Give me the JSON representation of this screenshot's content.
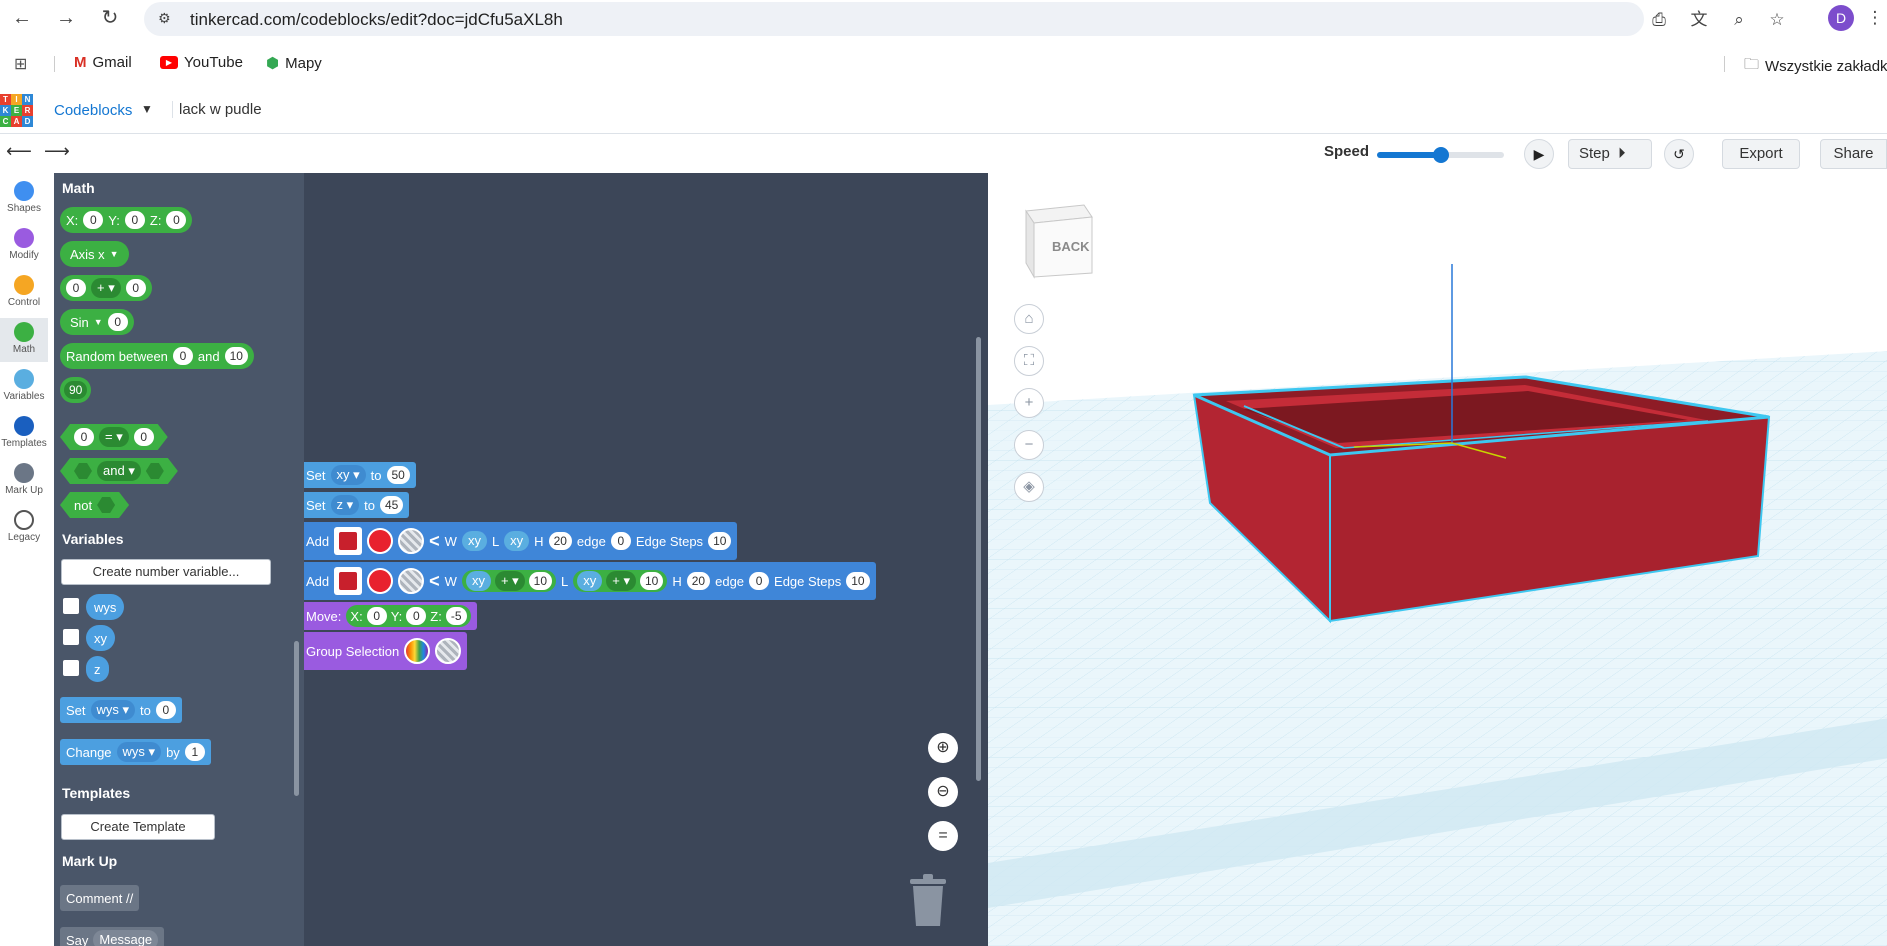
{
  "browser": {
    "url": "tinkercad.com/codeblocks/edit?doc=jdCfu5aXL8h",
    "profile_initial": "D",
    "bookmarks": [
      "Gmail",
      "YouTube",
      "Mapy"
    ],
    "all_bookmarks": "Wszystkie zakładki"
  },
  "header": {
    "logo_letters": [
      "T",
      "I",
      "N",
      "K",
      "E",
      "R",
      "C",
      "A",
      "D"
    ],
    "app_name": "Codeblocks",
    "doc_name": "lack w pudle"
  },
  "toolbar": {
    "speed_label": "Speed",
    "speed_value": 0.5,
    "step_label": "Step",
    "export_label": "Export",
    "share_label": "Share"
  },
  "categories": [
    {
      "label": "Shapes",
      "color": "#3f8ff0"
    },
    {
      "label": "Modify",
      "color": "#9a5be0"
    },
    {
      "label": "Control",
      "color": "#f5a623"
    },
    {
      "label": "Math",
      "color": "#3cb043"
    },
    {
      "label": "Variables",
      "color": "#5aaee0"
    },
    {
      "label": "Templates",
      "color": "#1a5fbf"
    },
    {
      "label": "Mark Up",
      "color": "#6b7686"
    },
    {
      "label": "Legacy",
      "color": "#ffffff"
    }
  ],
  "palette": {
    "math_title": "Math",
    "xyz_labels": [
      "X:",
      "Y:",
      "Z:"
    ],
    "xyz_values": [
      "0",
      "0",
      "0"
    ],
    "axis_label": "Axis x",
    "arith": {
      "a": "0",
      "op": "+",
      "b": "0"
    },
    "sin_label": "Sin",
    "sin_value": "0",
    "random_label": "Random between",
    "random_and": "and",
    "random_min": "0",
    "random_max": "10",
    "number_block": "90",
    "compare": {
      "a": "0",
      "op": "=",
      "b": "0"
    },
    "and_label": "and",
    "not_label": "not",
    "variables_title": "Variables",
    "create_var_btn": "Create number variable...",
    "vars": [
      "wys",
      "xy",
      "z"
    ],
    "set_label": "Set",
    "set_var": "wys",
    "set_to": "to",
    "set_value": "0",
    "change_label": "Change",
    "change_var": "wys",
    "change_by": "by",
    "change_value": "1",
    "templates_title": "Templates",
    "create_template_btn": "Create Template",
    "markup_title": "Mark Up",
    "comment_label": "Comment //",
    "say_label": "Say",
    "say_message": "Message"
  },
  "workspace": {
    "set1": {
      "label": "Set",
      "var": "xy",
      "to": "to",
      "value": "50"
    },
    "set2": {
      "label": "Set",
      "var": "z",
      "to": "to",
      "value": "45"
    },
    "add1": {
      "label": "Add",
      "w": "W",
      "w_var": "xy",
      "l": "L",
      "l_var": "xy",
      "h": "H",
      "h_val": "20",
      "edge": "edge",
      "edge_val": "0",
      "steps": "Edge Steps",
      "steps_val": "10"
    },
    "add2": {
      "label": "Add",
      "w": "W",
      "w_var": "xy",
      "w_op": "+",
      "w_add": "10",
      "l": "L",
      "l_var": "xy",
      "l_op": "+",
      "l_add": "10",
      "h": "H",
      "h_val": "20",
      "edge": "edge",
      "edge_val": "0",
      "steps": "Edge Steps",
      "steps_val": "10"
    },
    "move": {
      "label": "Move:",
      "x": "X:",
      "x_val": "0",
      "y": "Y:",
      "y_val": "0",
      "z": "Z:",
      "z_val": "-5"
    },
    "group": {
      "label": "Group Selection"
    }
  },
  "viewport": {
    "viewcube_label": "BACK",
    "box_color": "#b52430",
    "outline_color": "#3ec7f0"
  }
}
